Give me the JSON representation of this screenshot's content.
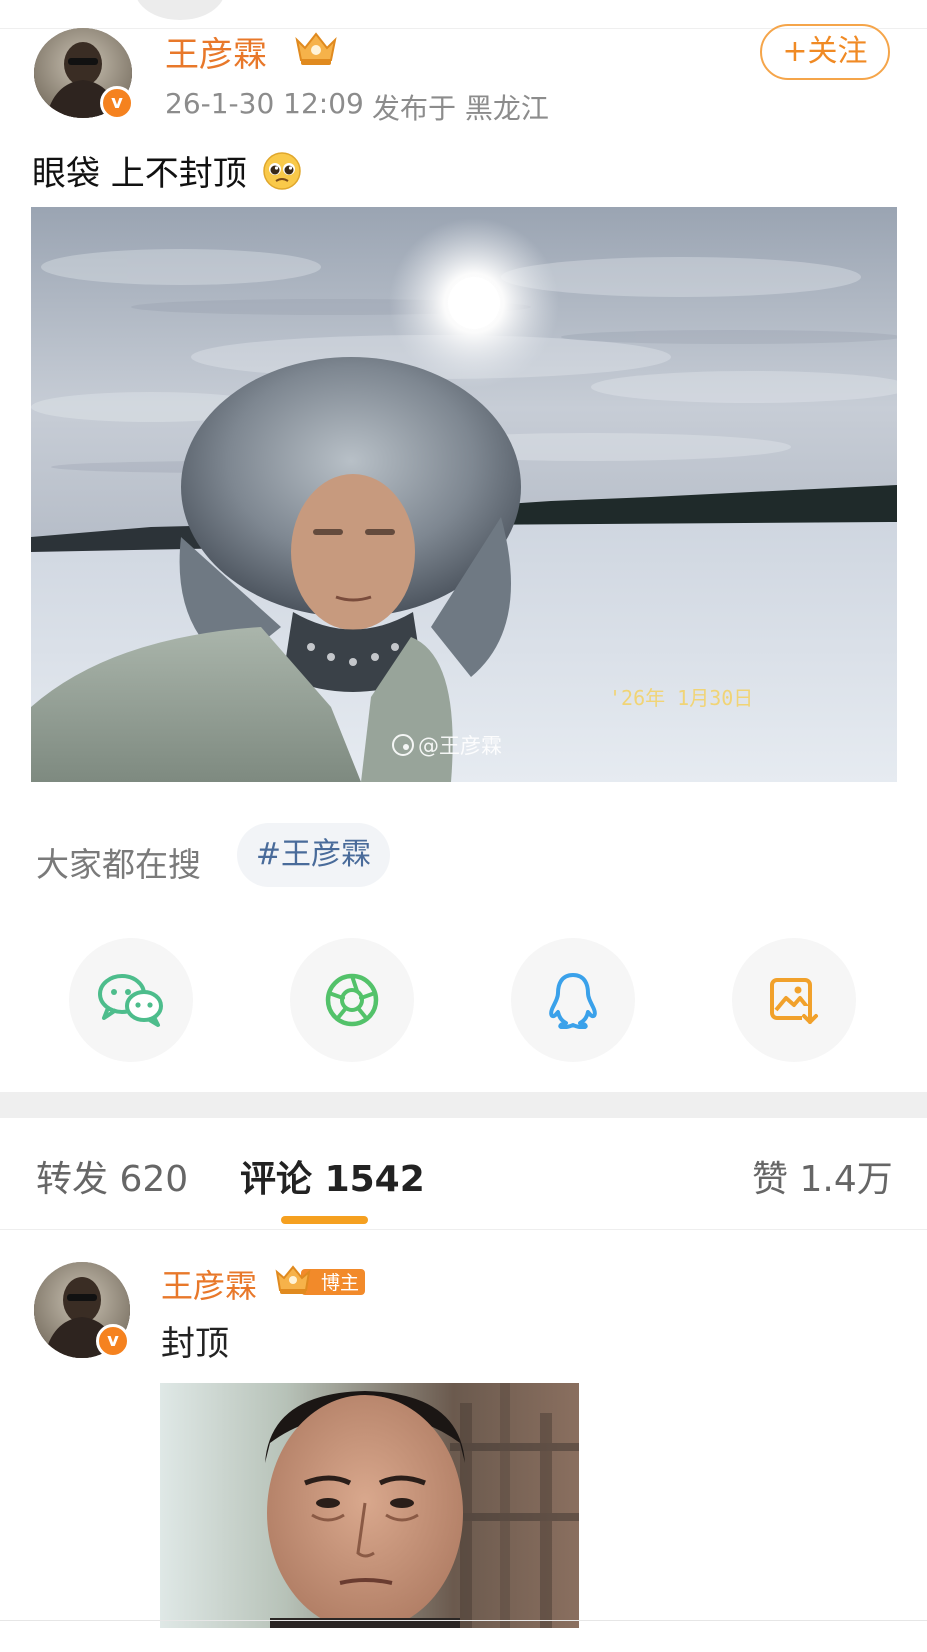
{
  "post": {
    "author": {
      "name": "王彦霖",
      "verified_icon": "v-badge-icon",
      "rank_icon": "crown-badge-icon"
    },
    "timestamp": "26-1-30 12:09",
    "location": "发布于 黑龙江",
    "follow_label": "+关注",
    "text": "眼袋 上不封顶",
    "text_emoji": "pleading-face-emoji",
    "photo": {
      "description": "selfie in fur trapper hat on snowy field",
      "date_stamp": "'26年 1月30日",
      "watermark": "@王彦霖"
    }
  },
  "search": {
    "label": "大家都在搜",
    "tag": "#王彦霖"
  },
  "share": [
    {
      "name": "wechat",
      "icon": "wechat-icon",
      "color": "#4dbd8c"
    },
    {
      "name": "moments",
      "icon": "moments-icon",
      "color": "#53c26a"
    },
    {
      "name": "qq",
      "icon": "qq-icon",
      "color": "#3aa1ea"
    },
    {
      "name": "save-image",
      "icon": "save-image-icon",
      "color": "#f1a12b"
    }
  ],
  "tabs": {
    "repost": {
      "label": "转发",
      "count": "620"
    },
    "comment": {
      "label": "评论",
      "count": "1542"
    },
    "like": {
      "label": "赞",
      "count": "1.4万"
    }
  },
  "comment": {
    "author": "王彦霖",
    "badge": "博主",
    "text": "封顶",
    "photo": "close-up portrait of older man"
  },
  "colors": {
    "accent_orange": "#e8782a",
    "follow_border": "#f5a54a",
    "tab_indicator": "#f5a020",
    "hashtag_text": "#496b9a"
  }
}
